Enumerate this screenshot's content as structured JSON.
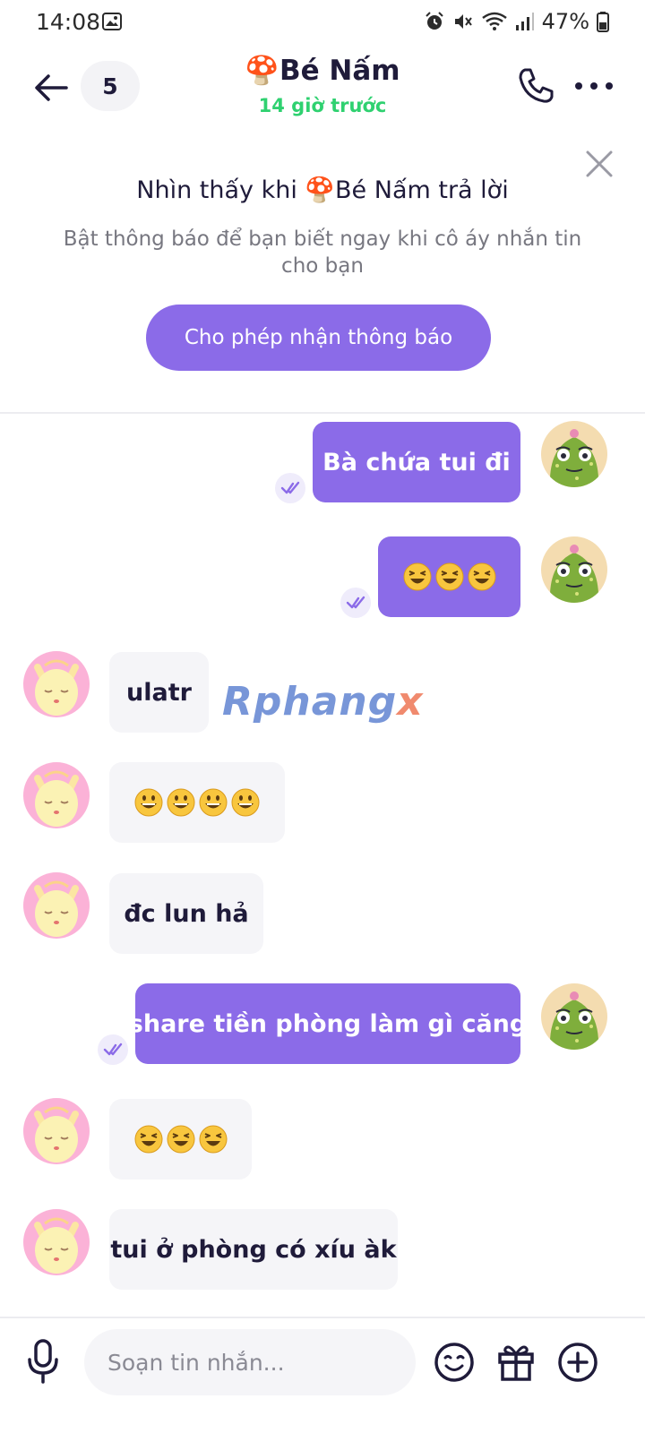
{
  "status_bar": {
    "time": "14:08",
    "battery": "47%"
  },
  "header": {
    "unread_count": "5",
    "contact_name": "🍄Bé Nấm",
    "contact_status": "14 giờ trước",
    "status_color": "#2fd170"
  },
  "banner": {
    "title": "Nhìn thấy khi 🍄Bé Nấm trả lời",
    "description": "Bật thông báo để bạn biết ngay khi cô áy nhắn tin cho bạn",
    "button_label": "Cho phép nhận thông báo",
    "accent": "#8b6be8"
  },
  "messages": [
    {
      "direction": "out",
      "text": "Bà chứa tui đi",
      "read": true
    },
    {
      "direction": "out",
      "emoji": "laughing",
      "emoji_count": 3,
      "read": true
    },
    {
      "direction": "in",
      "text": "ulatr"
    },
    {
      "direction": "in",
      "emoji": "grinning",
      "emoji_count": 4
    },
    {
      "direction": "in",
      "text": "đc lun hả"
    },
    {
      "direction": "out",
      "text": "share tiền phòng làm gì căng",
      "read": true
    },
    {
      "direction": "in",
      "emoji": "laughing",
      "emoji_count": 3
    },
    {
      "direction": "in",
      "text": "tui ở phòng có xíu àk"
    }
  ],
  "watermark": {
    "main": "Rphang",
    "last": "x"
  },
  "composer": {
    "placeholder": "Soạn tin nhắn..."
  },
  "icons": [
    "back-arrow-icon",
    "phone-icon",
    "more-icon",
    "close-icon",
    "read-check-icon",
    "mic-icon",
    "sticker-icon",
    "gift-icon",
    "plus-icon"
  ]
}
